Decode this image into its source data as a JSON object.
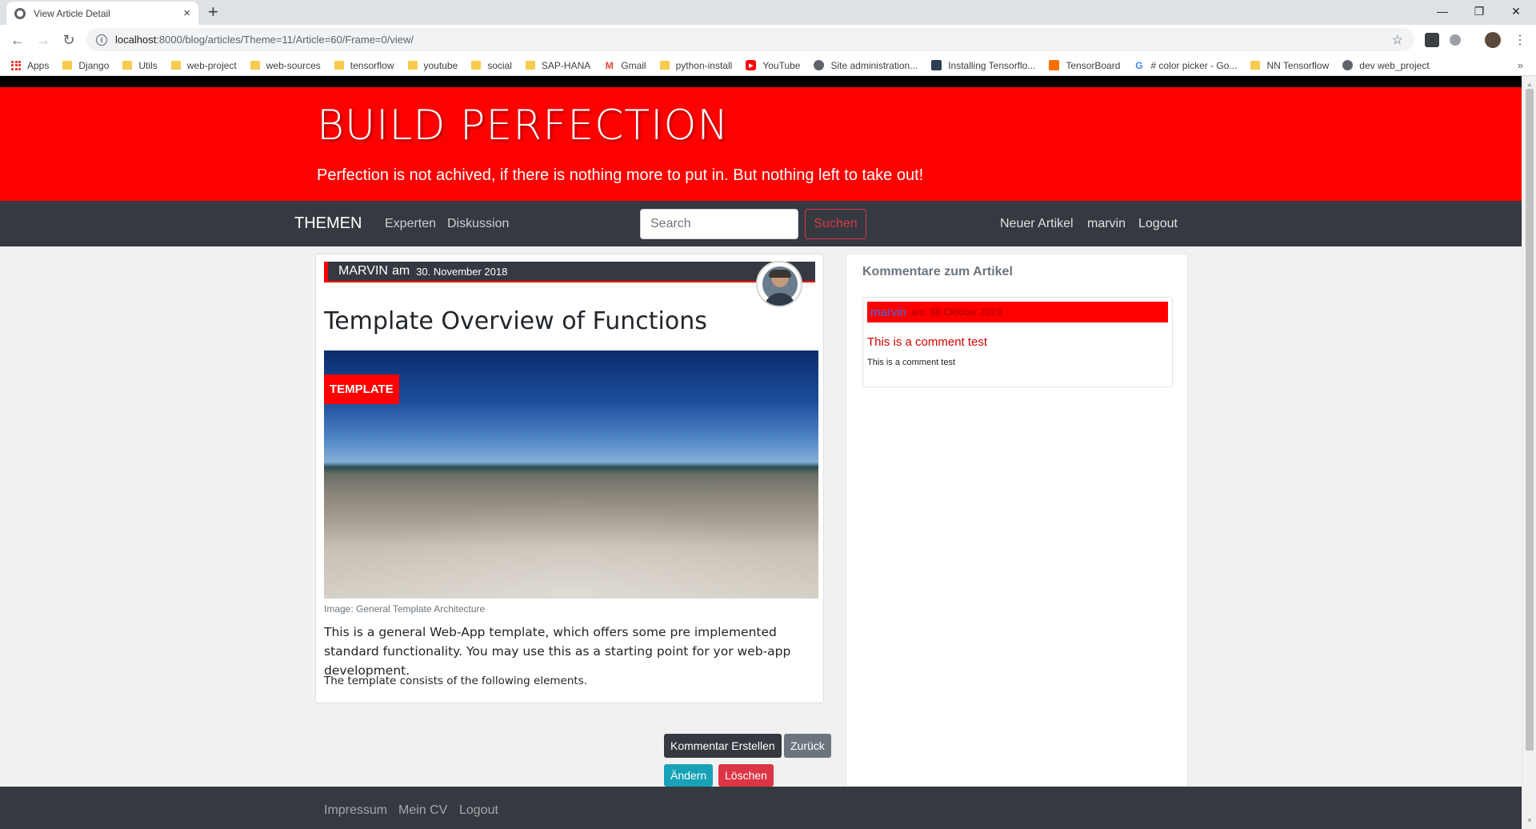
{
  "browser": {
    "tab_title": "View Article Detail",
    "tab_close": "×",
    "new_tab": "+",
    "url_host": "localhost",
    "url_path": ":8000/blog/articles/Theme=11/Article=60/Frame=0/view/",
    "bookmarks": [
      "Apps",
      "Django",
      "Utils",
      "web-project",
      "web-sources",
      "tensorflow",
      "youtube",
      "social",
      "SAP-HANA",
      "Gmail",
      "python-install",
      "YouTube",
      "Site administration...",
      "Installing Tensorflo...",
      "TensorBoard",
      "# color picker - Go...",
      "NN Tensorflow",
      "dev web_project"
    ],
    "bookmarks_more": "»"
  },
  "site": {
    "title": "BUILD PERFECTION",
    "tagline": "Perfection is not achived, if there is nothing more to put in. But nothing left to take out!"
  },
  "nav": {
    "brand": "THEMEN",
    "links": [
      "Experten",
      "Diskussion"
    ],
    "search_placeholder": "Search",
    "search_button": "Suchen",
    "right_links": [
      "Neuer Artikel",
      "marvin",
      "Logout"
    ]
  },
  "article": {
    "author": "MARVIN",
    "am": "am",
    "date": "30. November 2018",
    "title": "Template Overview of Functions",
    "badge": "TEMPLATE",
    "image_caption": "Image: General Template Architecture",
    "lead": "This is a general Web-App template, which offers some pre implemented standard functionality. You may use this as a starting point for yor web-app development.",
    "body": "The template consists of the following elements."
  },
  "actions": {
    "comment": "Kommentar Erstellen",
    "back": "Zurück",
    "edit": "Ändern",
    "delete": "Löschen"
  },
  "comments": {
    "heading": "Kommentare zum Artikel",
    "items": [
      {
        "author": "marvin",
        "date": "am: 08 Oktober 2019",
        "title": "This is a comment test",
        "body": "This is a comment test"
      }
    ]
  },
  "footer": {
    "links": [
      "Impressum",
      "Mein CV",
      "Logout"
    ]
  },
  "colors": {
    "brand_red": "#ff0000",
    "nav_dark": "#343a40",
    "danger": "#dc3545",
    "info": "#17a2b8",
    "secondary": "#6c757d"
  }
}
